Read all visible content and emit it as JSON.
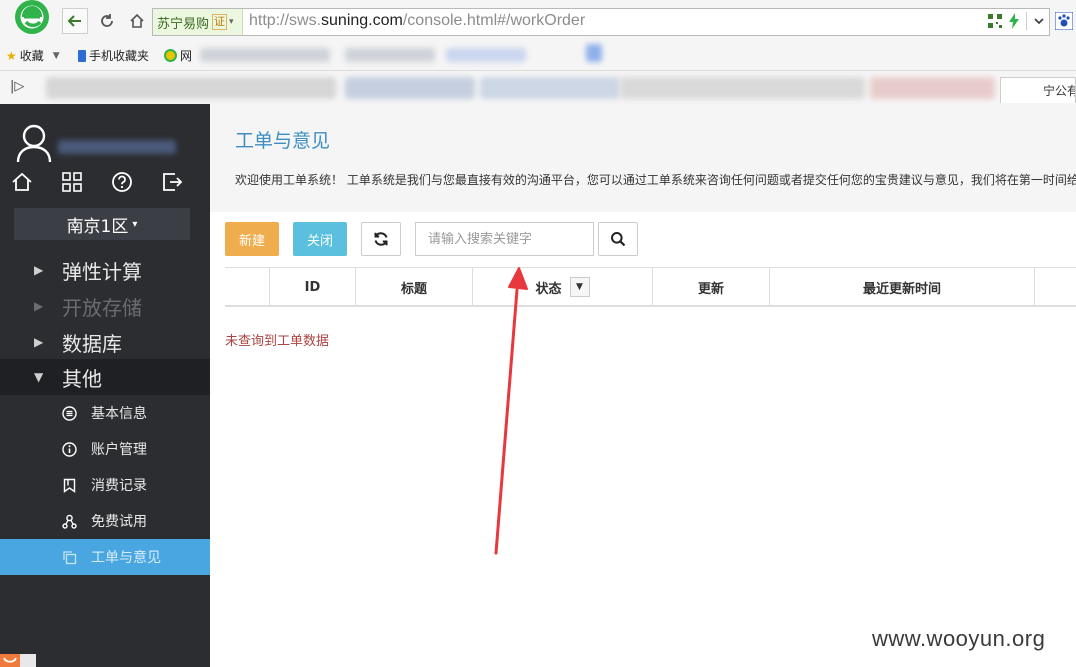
{
  "browser": {
    "site_badge": "苏宁易购",
    "cert_badge": "证",
    "url_prefix": "http://sws.",
    "url_domain": "suning.com",
    "url_suffix": "/console.html#/workOrder",
    "bookmarks": {
      "favorites": "收藏",
      "mobile_favorites": "手机收藏夹",
      "web": "网"
    },
    "tab_partial_right": "宁公有"
  },
  "sidebar": {
    "region": "南京1区",
    "menu": [
      {
        "label": "弹性计算",
        "state": "collapsed"
      },
      {
        "label": "开放存储",
        "state": "disabled"
      },
      {
        "label": "数据库",
        "state": "collapsed"
      },
      {
        "label": "其他",
        "state": "expanded"
      }
    ],
    "submenu": [
      {
        "label": "基本信息",
        "icon": "list-circle-icon"
      },
      {
        "label": "账户管理",
        "icon": "info-circle-icon"
      },
      {
        "label": "消费记录",
        "icon": "bookmark-icon"
      },
      {
        "label": "免费试用",
        "icon": "nodes-icon"
      },
      {
        "label": "工单与意见",
        "icon": "copy-icon",
        "selected": true
      }
    ]
  },
  "main": {
    "title": "工单与意见",
    "description": "欢迎使用工单系统！ 工单系统是我们与您最直接有效的沟通平台，您可以通过工单系统来咨询任何问题或者提交任何您的宝贵建议与意见，我们将在第一时间给",
    "toolbar": {
      "new_label": "新建",
      "close_label": "关闭",
      "search_placeholder": "请输入搜索关键字"
    },
    "table": {
      "columns": [
        "",
        "ID",
        "标题",
        "状态",
        "更新",
        "最近更新时间",
        ""
      ],
      "empty_message": "未查询到工单数据"
    }
  },
  "watermark": "www.wooyun.org",
  "colors": {
    "sidebar_bg": "#2b2d31",
    "accent_blue": "#4aa6e0",
    "title_blue": "#3d8fc2",
    "btn_new": "#f0ad4e",
    "btn_close": "#5bc0de",
    "empty_text": "#a94442",
    "arrow_red": "#e8383d"
  }
}
